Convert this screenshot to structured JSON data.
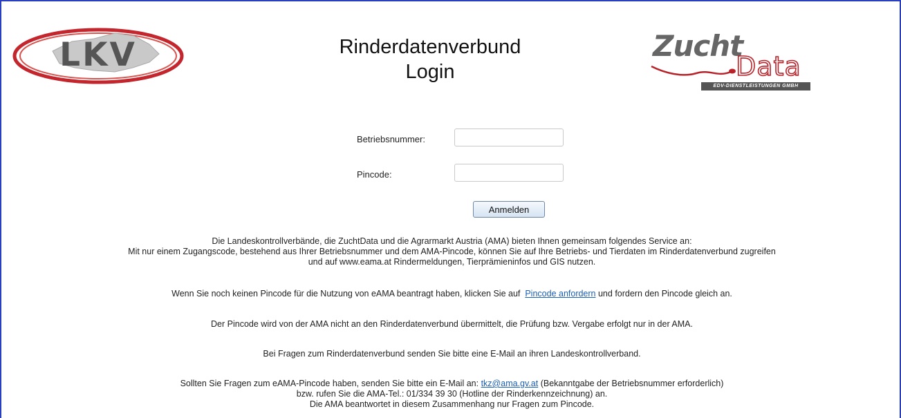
{
  "header": {
    "title_line1": "Rinderdatenverbund",
    "title_line2": "Login",
    "lkv_logo_text": "LKV",
    "zd_logo_zucht": "Zucht",
    "zd_logo_data": "Data",
    "zd_logo_banner": "EDV-DIENSTLEISTUNGEN GMBH"
  },
  "form": {
    "betriebsnummer_label": "Betriebsnummer:",
    "betriebsnummer_value": "",
    "pincode_label": "Pincode:",
    "pincode_value": "",
    "submit_label": "Anmelden"
  },
  "info": {
    "intro_line1": "Die Landeskontrollverbände, die ZuchtData und die Agrarmarkt Austria (AMA) bieten Ihnen gemeinsam folgendes Service an:",
    "intro_line2": "Mit nur einem Zugangscode, bestehend aus Ihrer Betriebsnummer und dem AMA-Pincode, können Sie auf Ihre Betriebs- und Tierdaten im Rinderdatenverbund zugreifen",
    "intro_line3": "und auf www.eama.at Rindermeldungen, Tierprämieninfos und GIS nutzen.",
    "pin_request_before": "Wenn Sie noch keinen Pincode für die Nutzung von eAMA beantragt haben, klicken Sie auf",
    "pin_request_link": "Pincode anfordern",
    "pin_request_after": "und fordern den Pincode gleich an.",
    "pin_transfer": "Der Pincode wird von der AMA nicht an den Rinderdatenverbund übermittelt, die Prüfung bzw. Vergabe erfolgt nur in der AMA.",
    "questions_rdv": "Bei Fragen zum Rinderdatenverbund senden Sie bitte eine E-Mail an ihren Landeskontrollverband.",
    "questions_pin_before": "Sollten Sie Fragen zum eAMA-Pincode haben, senden Sie bitte ein E-Mail an:",
    "questions_pin_email": "tkz@ama.gv.at",
    "questions_pin_after": "(Bekanntgabe der Betriebsnummer erforderlich)",
    "questions_pin_line2": "bzw. rufen Sie die AMA-Tel.: 01/334 39 30 (Hotline der Rinderkennzeichnung) an.",
    "questions_pin_line3": "Die AMA beantwortet in diesem Zusammenhang nur Fragen zum Pincode."
  },
  "colors": {
    "frame": "#2a3fbf",
    "link": "#1a5fb4",
    "lkv_red": "#b8232a",
    "zd_red": "#b8232a"
  }
}
